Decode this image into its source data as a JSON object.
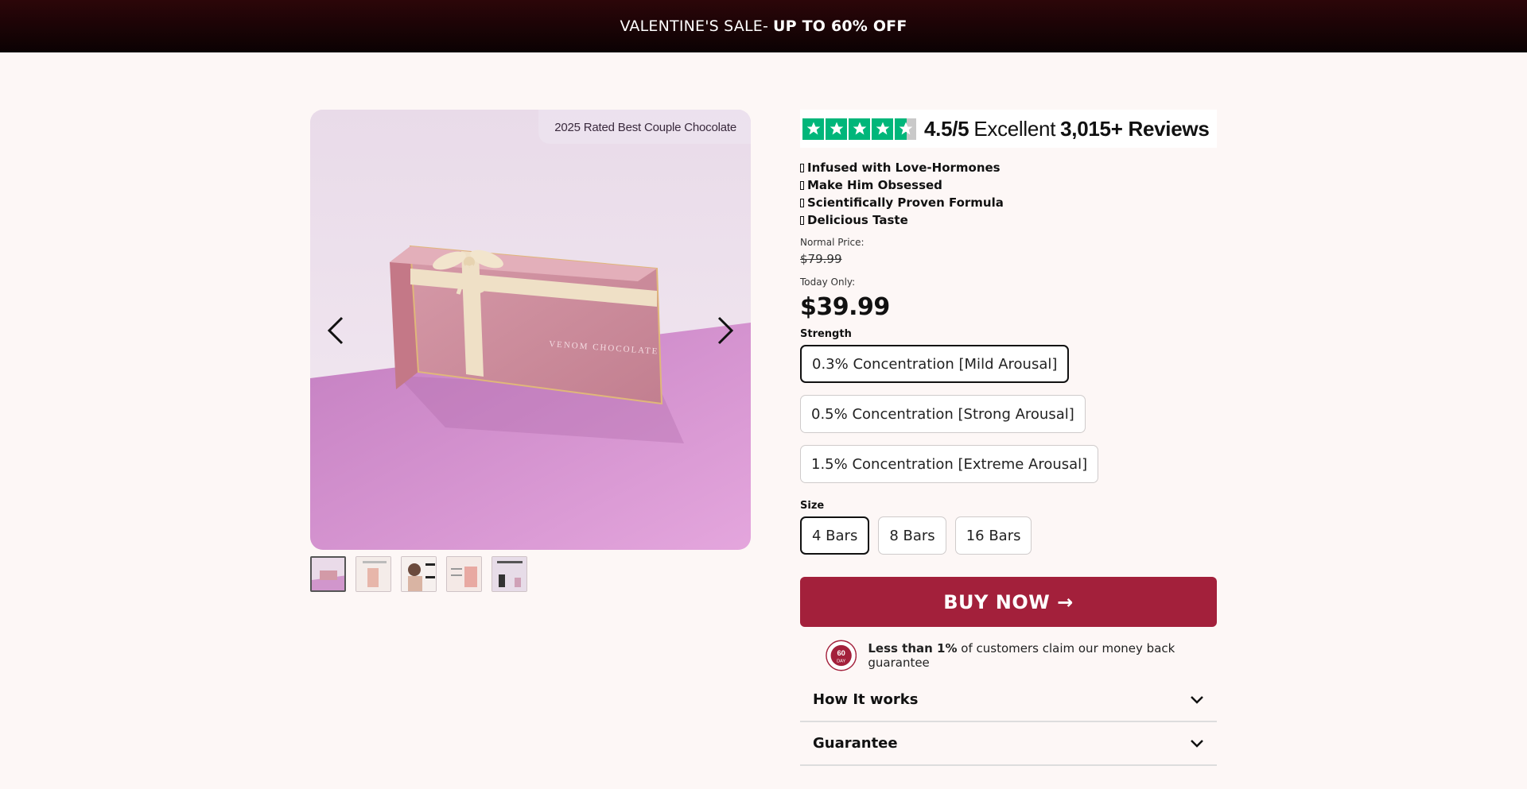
{
  "announcement": {
    "prefix": "VALENTINE'S SALE- ",
    "highlight": "UP TO 60% OFF"
  },
  "gallery": {
    "badge": "2025 Rated Best Couple Chocolate",
    "product_box_text": "VENOM CHOCOLATE",
    "thumbnail_count": 5,
    "active_thumbnail": 1
  },
  "trustpilot": {
    "score": "4.5/5",
    "label": "Excellent",
    "reviews": "3,015+ Reviews",
    "rating": 4.5
  },
  "benefits": [
    "Infused with Love-Hormones",
    "Make Him Obsessed",
    "Scientifically Proven Formula",
    "Delicious Taste"
  ],
  "pricing": {
    "normal_label": "Normal Price:",
    "normal_price": "$79.99",
    "today_label": "Today Only:",
    "today_price": "$39.99"
  },
  "strength": {
    "title": "Strength",
    "options": [
      "0.3% Concentration [Mild Arousal]",
      "0.5% Concentration [Strong Arousal]",
      "1.5% Concentration [Extreme Arousal]"
    ],
    "selected": "0.3% Concentration [Mild Arousal]"
  },
  "size": {
    "title": "Size",
    "options": [
      "4 Bars",
      "8 Bars",
      "16 Bars"
    ],
    "selected": "4 Bars"
  },
  "cta": {
    "label": "BUY NOW →"
  },
  "guarantee": {
    "seal_text": "60",
    "seal_sub": "DAY",
    "bold": "Less than 1%",
    "rest": " of customers claim our money back guarantee"
  },
  "accordion": [
    {
      "title": "How It works"
    },
    {
      "title": "Guarantee"
    }
  ],
  "colors": {
    "announcement_bg": "#1d0406",
    "cta_bg": "#a3203b",
    "trust_green": "#00b67a",
    "page_bg": "#fdf7f6"
  }
}
